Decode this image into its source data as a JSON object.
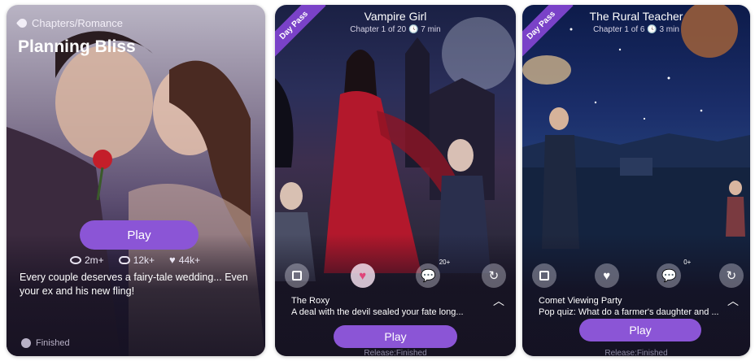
{
  "card1": {
    "genre": "Chapters/Romance",
    "title": "Planning Bliss",
    "play_label": "Play",
    "stats": [
      {
        "icon": "eye-icon",
        "value": "2m+"
      },
      {
        "icon": "comment-icon",
        "value": "12k+"
      },
      {
        "icon": "heart-icon",
        "value": "44k+"
      }
    ],
    "description": "Every couple deserves a fairy-tale wedding... Even your ex and his new fling!",
    "status": "Finished"
  },
  "card2": {
    "badge": "Day Pass",
    "title": "Vampire Girl",
    "chapter_info": "Chapter 1 of 20",
    "duration": "7 min",
    "actions": [
      {
        "icon": "book-icon"
      },
      {
        "icon": "heart-icon"
      },
      {
        "icon": "comment-icon",
        "count": "20+"
      },
      {
        "icon": "refresh-icon"
      }
    ],
    "episode_title": "The Roxy",
    "episode_desc": "A deal with the devil sealed your fate long...",
    "play_label": "Play",
    "release": "Release:Finished"
  },
  "card3": {
    "badge": "Day Pass",
    "title": "The Rural Teacher",
    "chapter_info": "Chapter 1 of 6",
    "duration": "3 min",
    "actions": [
      {
        "icon": "book-icon"
      },
      {
        "icon": "heart-icon"
      },
      {
        "icon": "comment-icon",
        "count": "0+"
      },
      {
        "icon": "refresh-icon"
      }
    ],
    "episode_title": "Comet Viewing Party",
    "episode_desc": "Pop quiz: What do a farmer's daughter and ...",
    "play_label": "Play",
    "release": "Release:Finished"
  },
  "colors": {
    "accent": "#8b55d6",
    "badge": "#7a42c8",
    "heart": "#e0457a"
  }
}
